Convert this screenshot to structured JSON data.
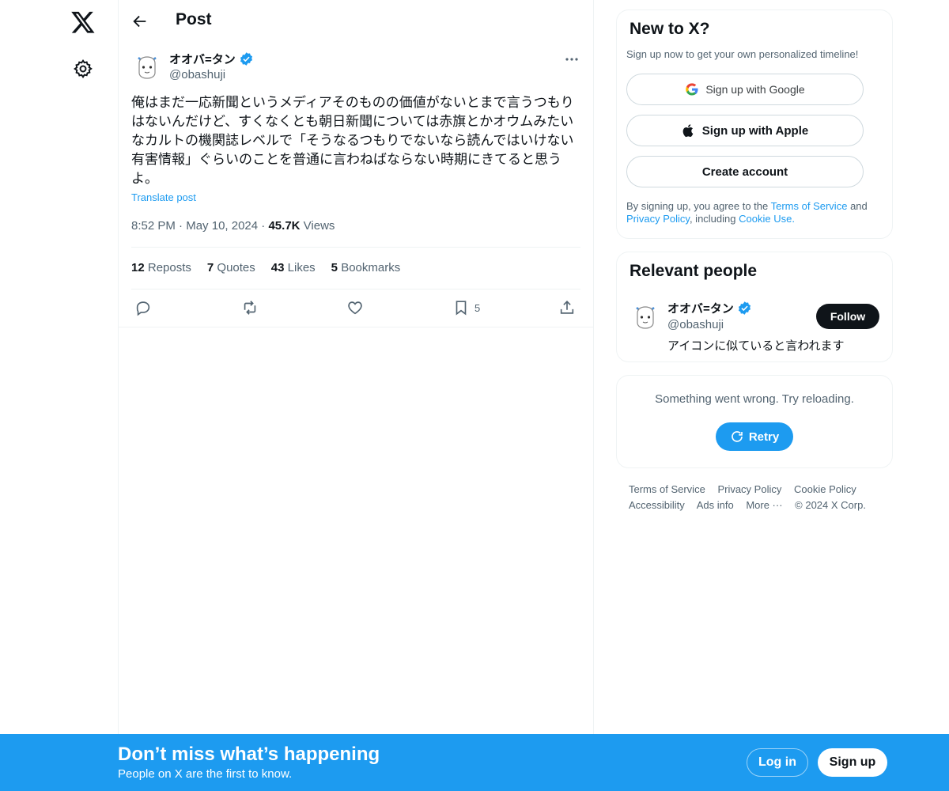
{
  "header": {
    "title": "Post"
  },
  "post": {
    "author_name": "オオバ=タン",
    "author_handle": "@obashuji",
    "text": "俺はまだ一応新聞というメディアそのものの価値がないとまで言うつもりはないんだけど、すくなくとも朝日新聞については赤旗とかオウムみたいなカルトの機関誌レベルで「そうなるつもりでないなら読んではいけない有害情報」ぐらいのことを普通に言わねばならない時期にきてると思うよ。",
    "translate_label": "Translate post",
    "time": "8:52 PM",
    "date": "May 10, 2024",
    "views_count": "45.7K",
    "views_label": "Views",
    "stats": {
      "reposts_count": "12",
      "reposts_label": "Reposts",
      "quotes_count": "7",
      "quotes_label": "Quotes",
      "likes_count": "43",
      "likes_label": "Likes",
      "bookmarks_count": "5",
      "bookmarks_label": "Bookmarks"
    },
    "bookmark_action_count": "5"
  },
  "signup_card": {
    "title": "New to X?",
    "subtitle": "Sign up now to get your own personalized timeline!",
    "google_label": "Sign up with Google",
    "apple_label": "Sign up with Apple",
    "create_label": "Create account",
    "legal_prefix": "By signing up, you agree to the",
    "terms_link": "Terms of Service",
    "and": "and",
    "privacy_link": "Privacy Policy",
    "including": ", including",
    "cookie_link": "Cookie Use",
    "period": "."
  },
  "relevant_people": {
    "title": "Relevant people",
    "name": "オオバ=タン",
    "handle": "@obashuji",
    "bio": "アイコンに似ていると言われます",
    "follow_label": "Follow"
  },
  "error_card": {
    "message": "Something went wrong. Try reloading.",
    "retry_label": "Retry"
  },
  "footer": {
    "terms": "Terms of Service",
    "privacy": "Privacy Policy",
    "cookie": "Cookie Policy",
    "accessibility": "Accessibility",
    "ads": "Ads info",
    "more": "More ···",
    "copyright": "© 2024 X Corp."
  },
  "banner": {
    "title": "Don’t miss what’s happening",
    "subtitle": "People on X are the first to know.",
    "login_label": "Log in",
    "signup_label": "Sign up"
  },
  "colors": {
    "accent": "#1d9bf0",
    "text": "#0f1419",
    "muted": "#536471",
    "border": "#eff3f4"
  },
  "icons": [
    "x-logo-icon",
    "gear-icon",
    "back-arrow-icon",
    "verified-badge-icon",
    "more-icon",
    "reply-icon",
    "repost-icon",
    "like-icon",
    "bookmark-icon",
    "share-icon",
    "google-icon",
    "apple-icon",
    "retry-icon"
  ]
}
